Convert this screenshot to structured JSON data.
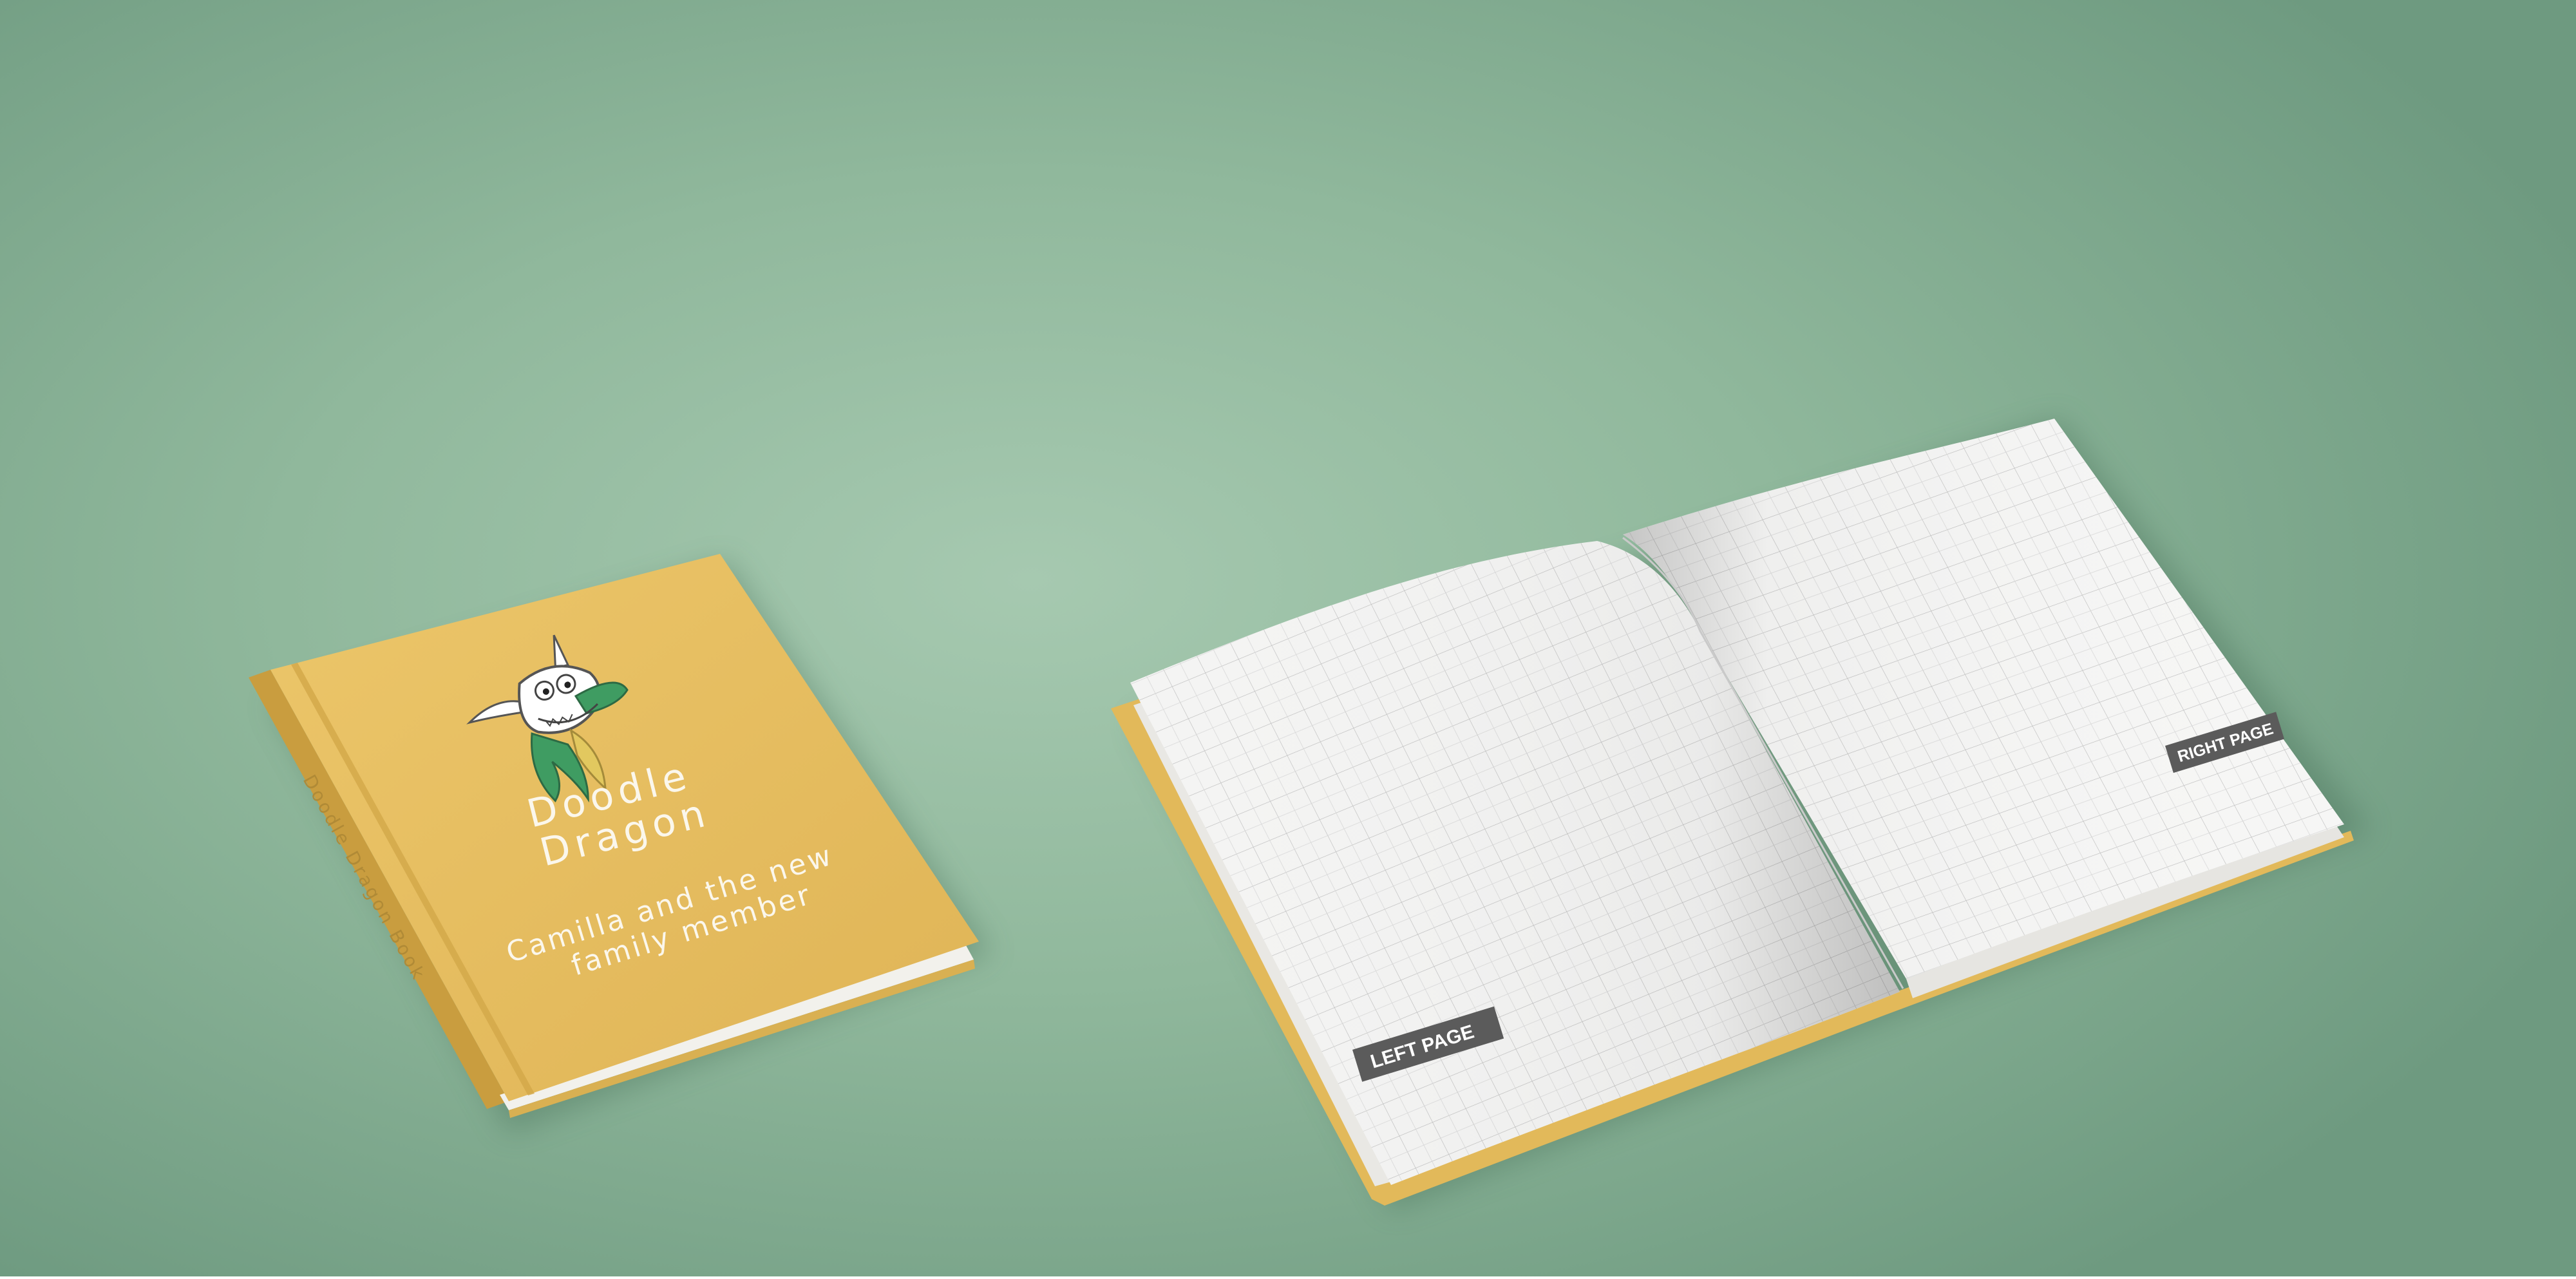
{
  "closed_book": {
    "title_line1": "Doodle",
    "title_line2": "Dragon",
    "subtitle_line1": "Camilla and the new",
    "subtitle_line2": "family member",
    "spine_text": "Doodle Dragon Book",
    "cover_color": "#e7bf5f",
    "mascot_icon": "dragon-head-icon"
  },
  "open_book": {
    "left_tag": "LEFT PAGE",
    "right_tag": "RIGHT PAGE",
    "cover_color": "#e2b95a"
  },
  "background_color": "#a6c9b0"
}
